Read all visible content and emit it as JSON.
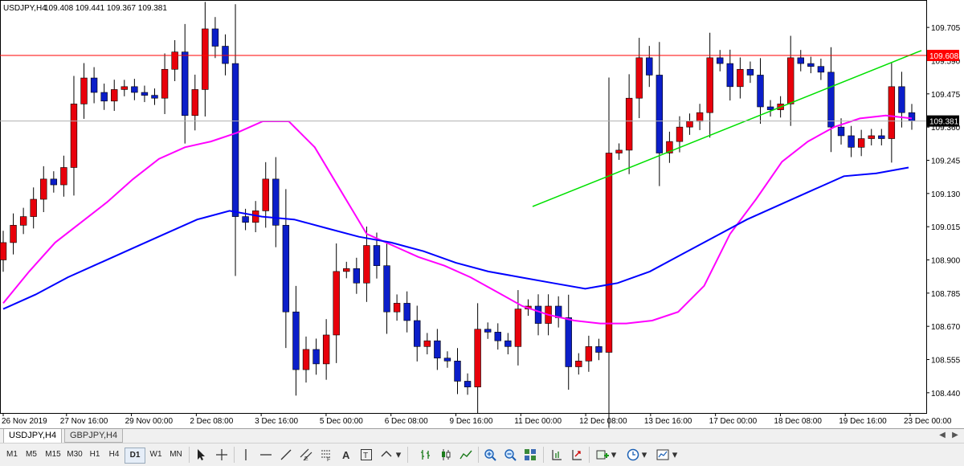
{
  "window": {
    "header_symbol": "USDJPY,H4",
    "header_ohlc": "109.408 109.441 109.367 109.381"
  },
  "chart_data": {
    "type": "candlestick",
    "symbol": "USDJPY",
    "timeframe": "H4",
    "ylim": [
      108.37,
      109.8
    ],
    "y_ticks": [
      "109.705",
      "109.590",
      "109.475",
      "109.360",
      "109.245",
      "109.130",
      "109.015",
      "108.900",
      "108.785",
      "108.670",
      "108.555",
      "108.440"
    ],
    "x_ticks": [
      "26 Nov 2019",
      "27 Nov 16:00",
      "29 Nov 00:00",
      "2 Dec 08:00",
      "3 Dec 16:00",
      "5 Dec 00:00",
      "6 Dec 08:00",
      "9 Dec 16:00",
      "11 Dec 00:00",
      "12 Dec 08:00",
      "13 Dec 16:00",
      "17 Dec 00:00",
      "18 Dec 08:00",
      "19 Dec 16:00",
      "23 Dec 00:00"
    ],
    "red_line_price": 109.608,
    "red_line_label": "109.608",
    "bid_line_price": 109.381,
    "bid_label": "109.381",
    "closes": [
      108.96,
      109.02,
      109.05,
      109.11,
      109.18,
      109.16,
      109.22,
      109.44,
      109.53,
      109.48,
      109.45,
      109.49,
      109.5,
      109.48,
      109.47,
      109.46,
      109.56,
      109.62,
      109.4,
      109.49,
      109.7,
      109.64,
      109.58,
      109.05,
      109.03,
      109.07,
      109.18,
      109.02,
      108.72,
      108.52,
      108.59,
      108.54,
      108.64,
      108.86,
      108.87,
      108.82,
      108.95,
      108.88,
      108.72,
      108.75,
      108.69,
      108.6,
      108.62,
      108.56,
      108.55,
      108.48,
      108.46,
      108.66,
      108.65,
      108.62,
      108.6,
      108.73,
      108.74,
      108.68,
      108.74,
      108.7,
      108.53,
      108.55,
      108.6,
      108.58,
      109.27,
      109.28,
      109.46,
      109.6,
      109.54,
      109.27,
      109.31,
      109.36,
      109.38,
      109.41,
      109.6,
      109.58,
      109.5,
      109.56,
      109.54,
      109.43,
      109.42,
      109.44,
      109.6,
      109.58,
      109.57,
      109.55,
      109.36,
      109.33,
      109.29,
      109.32,
      109.33,
      109.32,
      109.5,
      109.41,
      109.381
    ],
    "series": [
      {
        "name": "",
        "color": "#ff00ff",
        "values": [
          108.75,
          108.86,
          108.96,
          109.03,
          109.1,
          109.18,
          109.25,
          109.29,
          109.31,
          109.34,
          109.38,
          109.38,
          109.29,
          109.14,
          108.99,
          108.95,
          108.91,
          108.88,
          108.84,
          108.79,
          108.74,
          108.71,
          108.69,
          108.68,
          108.68,
          108.69,
          108.72,
          108.81,
          108.99,
          109.11,
          109.24,
          109.31,
          109.36,
          109.39,
          109.4,
          109.39
        ]
      },
      {
        "name": "",
        "color": "#0000ff",
        "values": [
          108.73,
          108.78,
          108.84,
          108.89,
          108.94,
          108.99,
          109.04,
          109.07,
          109.05,
          109.04,
          109.01,
          108.98,
          108.96,
          108.93,
          108.89,
          108.86,
          108.84,
          108.82,
          108.8,
          108.82,
          108.86,
          108.92,
          108.98,
          109.04,
          109.09,
          109.14,
          109.19,
          109.2,
          109.22
        ]
      }
    ]
  },
  "tabs": [
    {
      "label": "USDJPY,H4",
      "active": true
    },
    {
      "label": "GBPJPY,H4",
      "active": false
    }
  ],
  "toolbar": {
    "timeframes": [
      "M1",
      "M5",
      "M15",
      "M30",
      "H1",
      "H4",
      "D1",
      "W1",
      "MN"
    ],
    "active_timeframe": "H4"
  }
}
